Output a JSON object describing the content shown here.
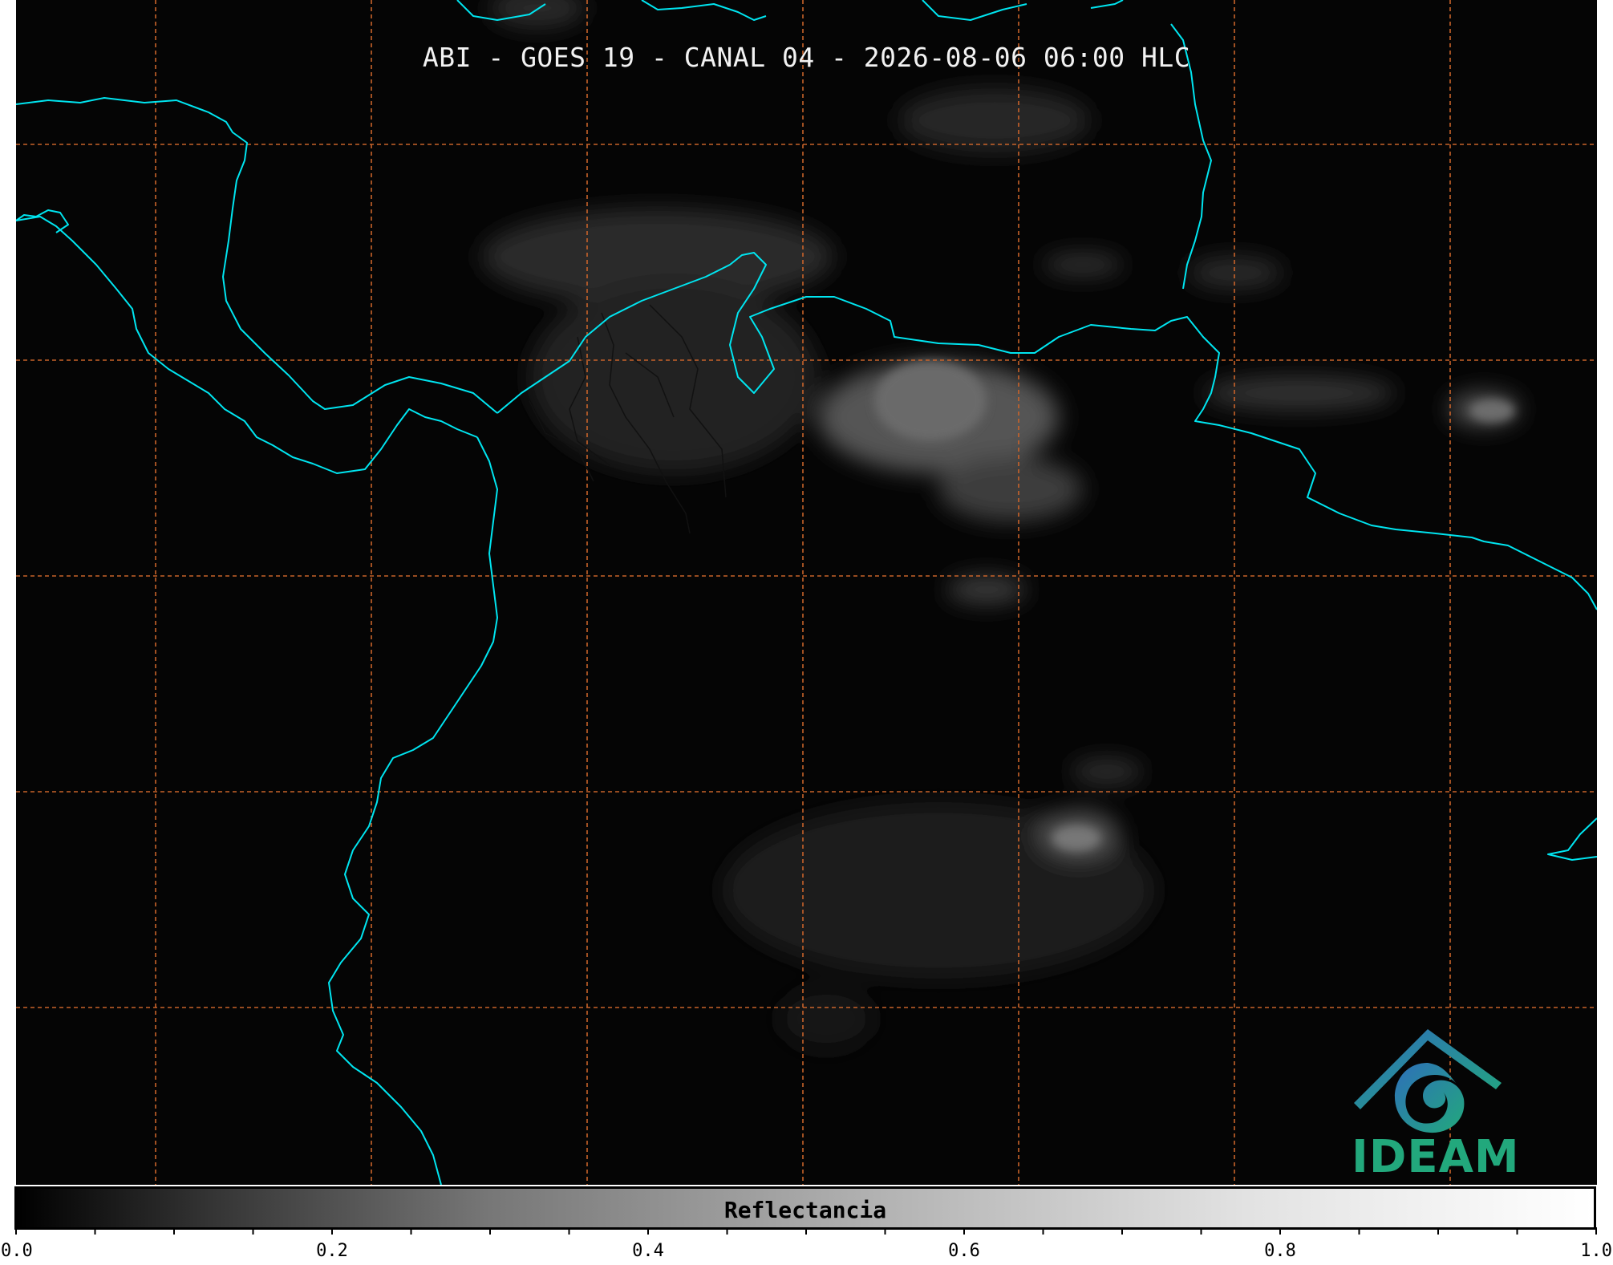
{
  "title": "ABI - GOES 19 - CANAL 04 - 2026-08-06 06:00 HLC",
  "logo": {
    "text": "IDEAM",
    "icon": "ideam-mountain-spiral-icon"
  },
  "colorbar": {
    "label": "Reflectancia",
    "min": 0.0,
    "max": 1.0,
    "major_ticks": [
      "0.0",
      "0.2",
      "0.4",
      "0.6",
      "0.8",
      "1.0"
    ],
    "minor_step": 0.05,
    "colormap": "grayscale"
  },
  "colors": {
    "background": "#050505",
    "coastline": "#00e5f0",
    "borders": "#111111",
    "gridlines": "#c8632a",
    "logo_primary": "#22a87c",
    "logo_secondary": "#2e6fba"
  }
}
